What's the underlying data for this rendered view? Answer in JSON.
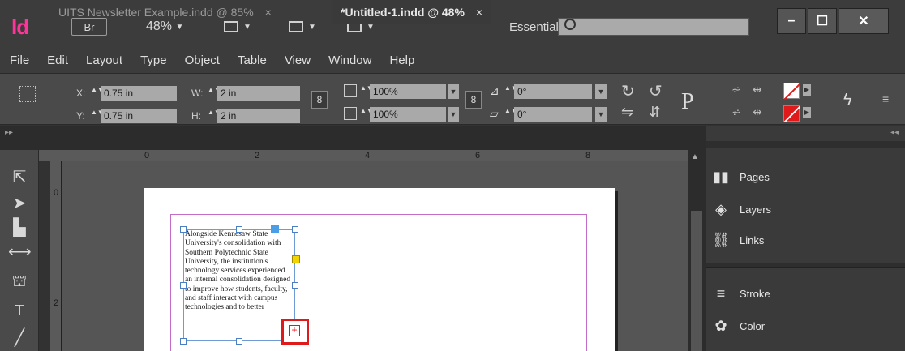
{
  "app": {
    "logo": "Id",
    "bridge": "Br",
    "zoom": "48%",
    "workspace": "Essentials",
    "search_placeholder": ""
  },
  "menu": [
    "File",
    "Edit",
    "Layout",
    "Type",
    "Object",
    "Table",
    "View",
    "Window",
    "Help"
  ],
  "control": {
    "x_label": "X:",
    "x_value": "0.75 in",
    "y_label": "Y:",
    "y_value": "0.75 in",
    "w_label": "W:",
    "w_value": "2 in",
    "h_label": "H:",
    "h_value": "2 in",
    "scale_x": "100%",
    "scale_y": "100%",
    "rotate": "0°",
    "shear": "0°"
  },
  "tabs": [
    {
      "label": "UITS Newsletter Example.indd @ 85%",
      "close": "×"
    },
    {
      "label": "*Untitled-1.indd @ 48%",
      "close": "×"
    }
  ],
  "ruler": {
    "h": [
      "0",
      "2",
      "4",
      "6",
      "8"
    ],
    "v": [
      "0",
      "2"
    ]
  },
  "story_text": "Alongside Kennesaw State University's consolidation with Southern Polytechnic State University, the institution's technology services experienced an internal consolidation designed to improve how students, faculty, and staff interact with campus technologies and to better",
  "panels": [
    {
      "label": "Pages",
      "icon": "pages-icon"
    },
    {
      "label": "Layers",
      "icon": "layers-icon"
    },
    {
      "label": "Links",
      "icon": "links-icon"
    },
    {
      "label": "Stroke",
      "icon": "stroke-icon"
    },
    {
      "label": "Color",
      "icon": "color-icon"
    }
  ],
  "colors": {
    "accent": "#ff3399",
    "overset": "#e01a1a",
    "margin": "#c36dc9",
    "frame": "#6f9ad3"
  }
}
